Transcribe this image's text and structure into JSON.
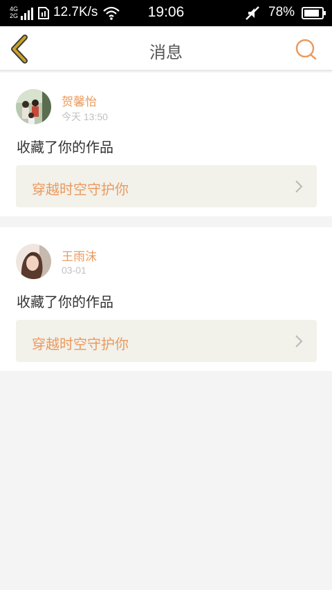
{
  "status_bar": {
    "network_top": "4G",
    "network_bottom": "2G",
    "speed": "12.7K/s",
    "time": "19:06",
    "battery": "78%",
    "icons": [
      "signal-icon",
      "sim-icon",
      "wifi-icon",
      "mute-icon",
      "battery-icon"
    ]
  },
  "header": {
    "title": "消息",
    "back_icon": "back-chevron-icon",
    "search_icon": "search-icon"
  },
  "messages": [
    {
      "user": "贺馨怡",
      "time": "今天 13:50",
      "action": "收藏了你的作品",
      "work": "穿越时空守护你",
      "avatar": "avatar-photo-children"
    },
    {
      "user": "王雨沫",
      "time": "03-01",
      "action": "收藏了你的作品",
      "work": "穿越时空守护你",
      "avatar": "avatar-photo-girl"
    }
  ],
  "colors": {
    "accent": "#ea9a5e",
    "back_icon": "#c9a226",
    "card_link_bg": "#f2f1ea",
    "page_bg": "#f4f4f4"
  }
}
